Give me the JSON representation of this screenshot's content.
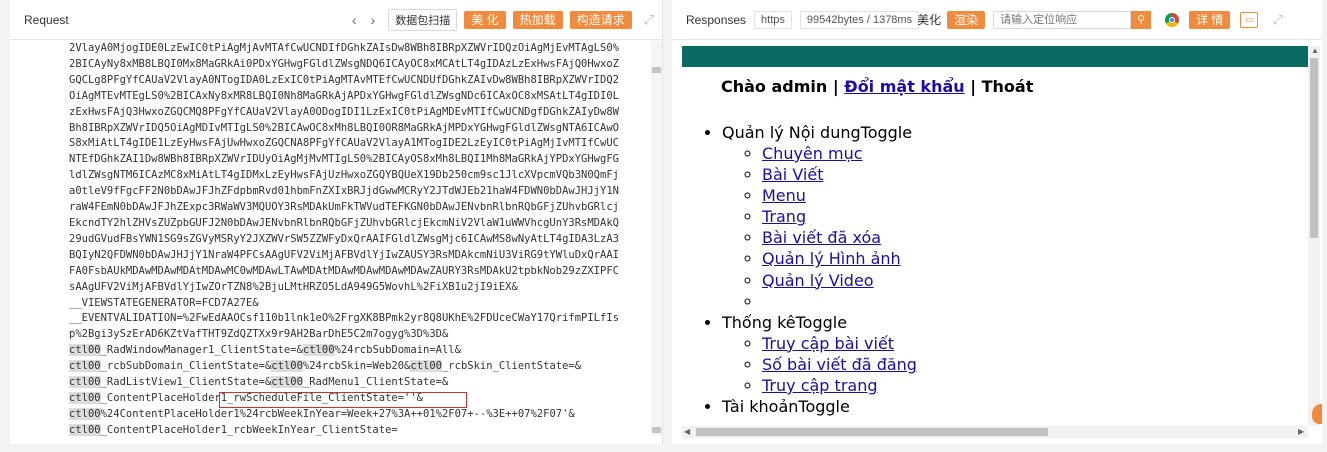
{
  "request_panel": {
    "title": "Request",
    "nav_prev": "‹",
    "nav_next": "›",
    "scan_button": "数据包扫描",
    "beautify_button": "美 化",
    "hot_load_button": "热加载",
    "build_request_button": "构造请求",
    "code_lines": [
      "2VlayA0MjogIDE0LzEwIC0tPiAgMjAvMTAfCwUCNDIfDGhkZAIsDw8WBh8IBRpXZWVrIDQzOiAgMjEvMTAgLS0%",
      "2BICAyNy8xMB8LBQI0Mx8MaGRkAi0PDxYGHwgFGldlZWsgNDQ6ICAyOC8xMCAtLT4gIDAzLzExHwsFAjQ0HwxoZ",
      "GQCLg8PFgYfCAUaV2VlayA0NTogIDA0LzExIC0tPiAgMTAvMTEfCwUCNDUfDGhkZAIvDw8WBh8IBRpXZWVrIDQ2",
      "OiAgMTEvMTEgLS0%2BICAxNy8xMR8LBQI0Nh8MaGRkAjAPDxYGHwgFGldlZWsgNDc6ICAxOC8xMSAtLT4gIDI0L",
      "zExHwsFAjQ3HwxoZGQCMQ8PFgYfCAUaV2VlayA0ODogIDI1LzExIC0tPiAgMDEvMTIfCwUCNDgfDGhkZAIyDw8W",
      "Bh8IBRpXZWVrIDQ5OiAgMDIvMTIgLS0%2BICAwOC8xMh8LBQI0OR8MaGRkAjMPDxYGHwgFGldlZWsgNTA6ICAwO",
      "S8xMiAtLT4gIDE1LzEyHwsFAjUwHwxoZGQCNA8PFgYfCAUaV2VlayA1MTogIDE2LzEyIC0tPiAgMjIvMTIfCwUC",
      "NTEfDGhkZAI1Dw8WBh8IBRpXZWVrIDUyOiAgMjMvMTIgLS0%2BICAyOS8xMh8LBQI1Mh8MaGRkAjYPDxYGHwgFG",
      "ldlZWsgNTM6ICAzMC8xMiAtLT4gIDMxLzEyHwsFAjUzHwxoZGQYBQUeX19Db250cm9sc1JlcXVpcmVQb3N0QmFj",
      "a0tleV9fFgcFF2N0bDAwJFJhZFdpbmRvd01hbmFnZXIxBRJjdGwwMCRyY2JTdWJEb21haW4FDWN0bDAwJHJjY1N",
      "raW4FEmN0bDAwJFJhZExpc3RWaWV3MQUOY3RsMDAkUmFkTWVudTEFKGN0bDAwJENvbnRlbnRQbGFjZUhvbGRlcj",
      "EkcndTY2hlZHVsZUZpbGUFJ2N0bDAwJENvbnRlbnRQbGFjZUhvbGRlcjEkcmNiV2VlaW1uWWVhcgUnY3RsMDAkQ",
      "29udGVudFBsYWN1SG9sZGVyMSRyY2JXZWVrSW5ZZWFyDxQrAAIFGldlZWsgMjc6ICAwMS8wNyAtLT4gIDA3LzA3",
      "BQIyN2QFDWN0bDAwJHJjY1NraW4PFCsAAgUFV2ViMjAFBVdlYjIwZAUSY3RsMDAkcmNiU3ViRG9tYWluDxQrAAI",
      "FA0FsbAUkMDAwMDAwMDAtMDAwMC0wMDAwLTAwMDAtMDAwMDAwMDAwMDAwZAURY3RsMDAkU2tpbkNob29zZXIPFC",
      "sAAgUFV2ViMjAFBVdlYjIwZOrTZN8%2BjuLMtHRZO5LdA949G5WovhL%2FiXB1u2jI9iEX&",
      "__VIEWSTATEGENERATOR=FCD7A27E&",
      "__EVENTVALIDATION=%2FwEdAAOCsf110b1lnk1eO%2FrgXK8BPmk2yr8Q8UKhE%2FDUceCWaY17QrifmPILfIs",
      "p%2Bgi3ySzErAD6KZtVafTHT9ZdQZTXx9r9AH2BarDhE5C2m7ogyg%3D%3D&",
      "ctl00_RadWindowManager1_ClientState=&ctl00%24rcbSubDomain=All&",
      "ctl00_rcbSubDomain_ClientState=&ctl00%24rcbSkin=Web20&ctl00_rcbSkin_ClientState=&",
      "ctl00_RadListView1_ClientState=&ctl00_RadMenu1_ClientState=&",
      "ctl00_ContentPlaceHolder1_rwScheduleFile_ClientState=''&",
      "ctl00%24ContentPlaceHolder1%24rcbWeekInYear=Week+27%3A++01%2F07+--%3E++07%2F07'&",
      "ctl00_ContentPlaceHolder1_rcbWeekInYear_ClientState="
    ]
  },
  "response_panel": {
    "title": "Responses",
    "protocol": "https",
    "size_info": "99542bytes / 1378ms",
    "beautify_label": "美化",
    "render_button": "渲染",
    "search_placeholder": "请输入定位响应",
    "details_button": "详 情",
    "preview": {
      "greeting_prefix": "Chào admin | ",
      "change_password": "Đổi mật khẩu",
      "separator": " | ",
      "logout": "Thoát",
      "menu": [
        {
          "label": "Quản lý Nội dungToggle",
          "items": [
            "Chuyên mục",
            "Bài Viết",
            "Menu",
            "Trang",
            "Bài viết đã xóa",
            "Quản lý Hình ảnh",
            "Quản lý Video",
            ""
          ]
        },
        {
          "label": "Thống kêToggle",
          "items": [
            "Truy cập bài viết",
            "Số bài viết đã đăng",
            "Truy cập trang"
          ]
        },
        {
          "label": "Tài khoảnToggle",
          "items": []
        }
      ]
    }
  },
  "colors": {
    "accent_orange": "#f08a3c",
    "teal_bar": "#0b6b63",
    "link": "#1a0dab",
    "highlight_box": "#d0302f"
  }
}
